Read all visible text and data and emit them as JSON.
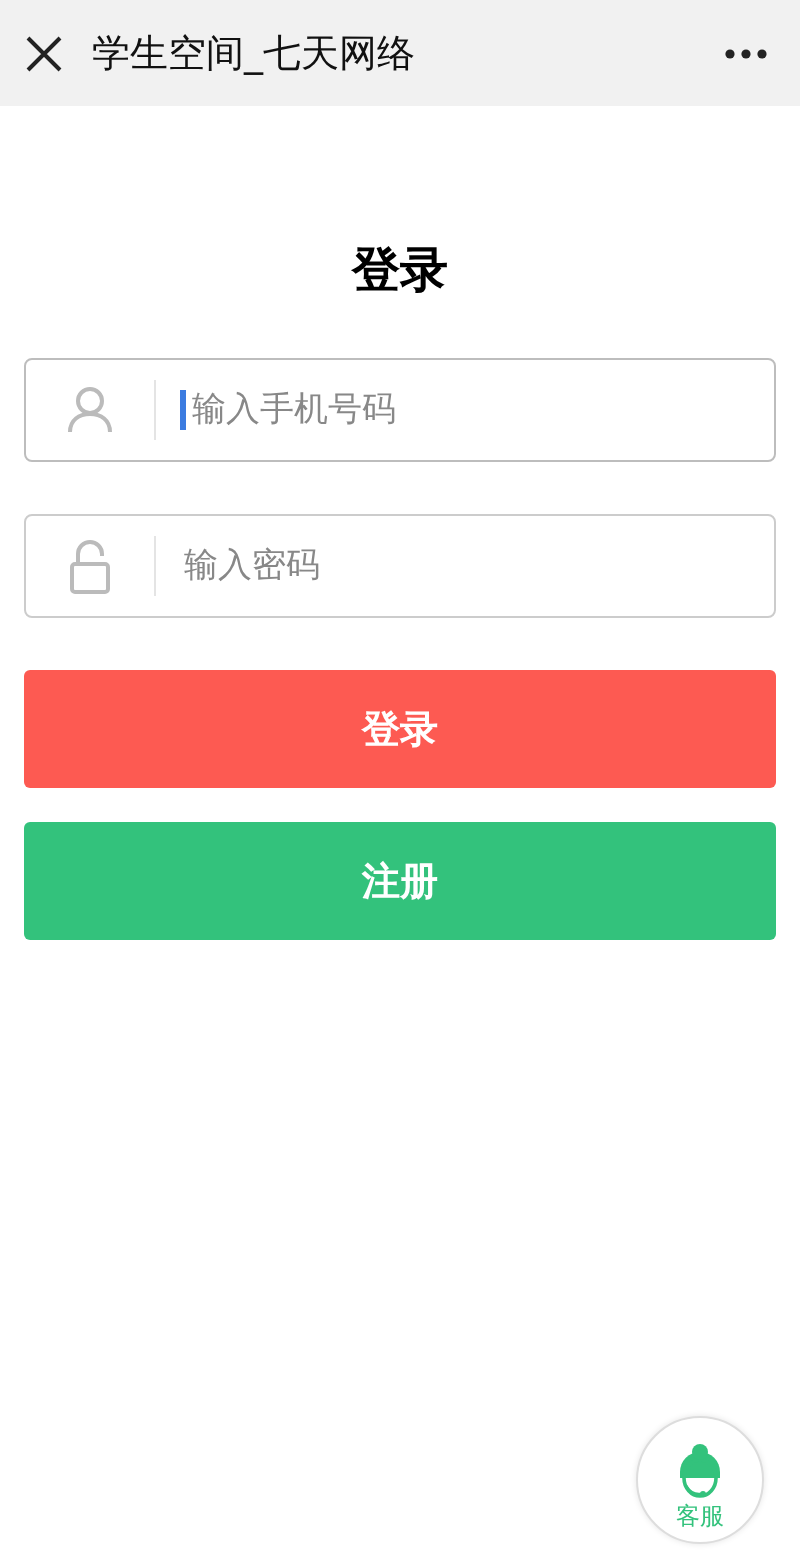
{
  "header": {
    "title": "学生空间_七天网络"
  },
  "heading": "登录",
  "fields": [
    {
      "kind": "user",
      "placeholder": "输入手机号码",
      "focused": true
    },
    {
      "kind": "lock",
      "placeholder": "输入密码",
      "focused": false
    }
  ],
  "buttons": [
    {
      "kind": "login",
      "label": "登录"
    },
    {
      "kind": "register",
      "label": "注册"
    }
  ],
  "service_button": {
    "label": "客服"
  }
}
